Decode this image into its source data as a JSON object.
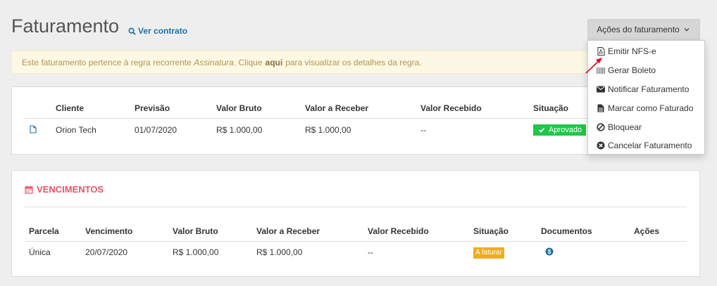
{
  "header": {
    "title": "Faturamento",
    "view_contract_label": "Ver contrato",
    "actions_label": "Ações do faturamento"
  },
  "alert": {
    "prefix": "Este faturamento pertence à regra recorrente",
    "rule_name": "Assinatura",
    "middle": ". Clique",
    "link": "aqui",
    "suffix": "para visualizar os detalhes da regra."
  },
  "billing": {
    "columns": [
      "Cliente",
      "Previsão",
      "Valor Bruto",
      "Valor a Receber",
      "Valor Recebido",
      "Situação"
    ],
    "row": {
      "cliente": "Orion Tech",
      "previsao": "01/07/2020",
      "valor_bruto": "R$ 1.000,00",
      "valor_a_receber": "R$ 1.000,00",
      "valor_recebido": "--",
      "situacao": "Aprovado"
    }
  },
  "vencimentos": {
    "title": "VENCIMENTOS",
    "columns": [
      "Parcela",
      "Vencimento",
      "Valor Bruto",
      "Valor a Receber",
      "Valor Recebido",
      "Situação",
      "Documentos",
      "Ações"
    ],
    "row": {
      "parcela": "Única",
      "vencimento": "20/07/2020",
      "valor_bruto": "R$ 1.000,00",
      "valor_a_receber": "R$ 1.000,00",
      "valor_recebido": "--",
      "situacao": "A faturar"
    }
  },
  "dropdown": {
    "items": [
      {
        "label": "Emitir NFS-e",
        "icon": "pdf-file-icon"
      },
      {
        "label": "Gerar Boleto",
        "icon": "barcode-icon"
      },
      {
        "label": "Notificar Faturamento",
        "icon": "envelope-icon"
      },
      {
        "label": "Marcar como Faturado",
        "icon": "document-icon"
      },
      {
        "label": "Bloquear",
        "icon": "block-icon"
      },
      {
        "label": "Cancelar Faturamento",
        "icon": "cancel-circle-icon"
      }
    ]
  },
  "colors": {
    "accent_blue": "#1f6fa8",
    "section_red": "#e8546b",
    "approved_green": "#1fc74a",
    "pending_orange": "#f0ad1d",
    "annotation_arrow": "#e3001b"
  }
}
